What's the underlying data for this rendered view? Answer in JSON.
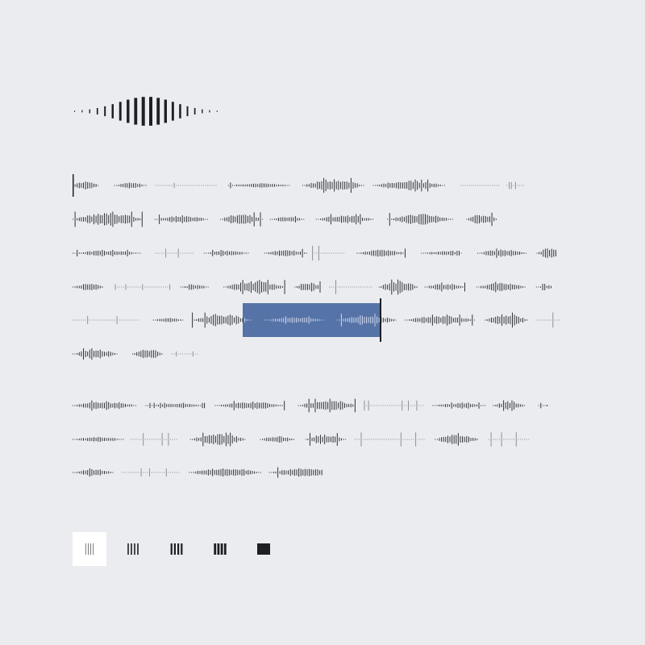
{
  "colors": {
    "background": "#ebecf0",
    "ink": "#1d1f24",
    "selection": "#5673a8",
    "selection_ink": "#dfe6f3",
    "active_button": "#ffffff"
  },
  "header": {
    "icon": "speech-waveform-icon"
  },
  "transcript": {
    "paragraphs": [
      {
        "lines": 6
      },
      {
        "lines": 3
      }
    ],
    "selection": {
      "paragraph": 1,
      "line": 5
    }
  },
  "density_options": {
    "items": [
      {
        "icon": "density-1-icon",
        "level": 1,
        "active": true
      },
      {
        "icon": "density-2-icon",
        "level": 2,
        "active": false
      },
      {
        "icon": "density-3-icon",
        "level": 3,
        "active": false
      },
      {
        "icon": "density-4-icon",
        "level": 4,
        "active": false
      },
      {
        "icon": "density-5-icon",
        "level": 5,
        "active": false
      }
    ]
  }
}
